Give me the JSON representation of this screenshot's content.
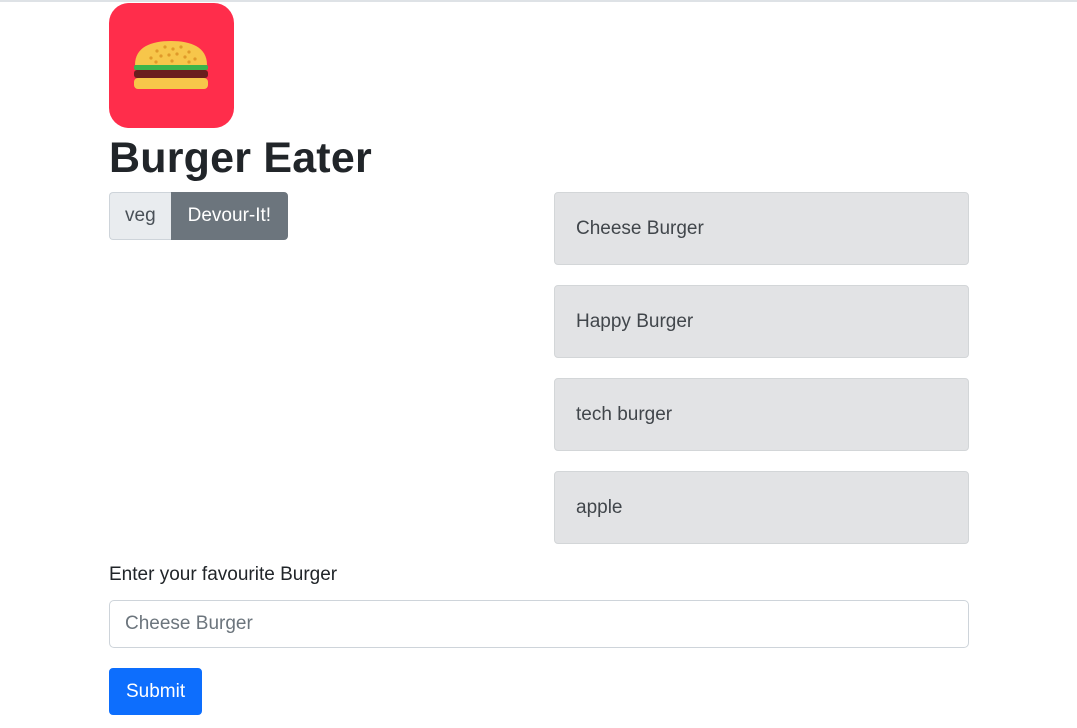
{
  "app": {
    "title": "Burger Eater",
    "logo_icon": "hamburger-icon"
  },
  "eaten": [
    {
      "name": "veg",
      "button_label": "Devour-It!"
    }
  ],
  "burgers": [
    {
      "name": "Cheese Burger"
    },
    {
      "name": "Happy Burger"
    },
    {
      "name": "tech burger"
    },
    {
      "name": "apple"
    }
  ],
  "form": {
    "label": "Enter your favourite Burger",
    "placeholder": "Cheese Burger",
    "value": "",
    "submit_label": "Submit"
  },
  "colors": {
    "logo_background": "#ff2d4b",
    "submit_button": "#0d6efd",
    "devour_button": "#6c757d",
    "burger_item_background": "#e2e3e5"
  }
}
